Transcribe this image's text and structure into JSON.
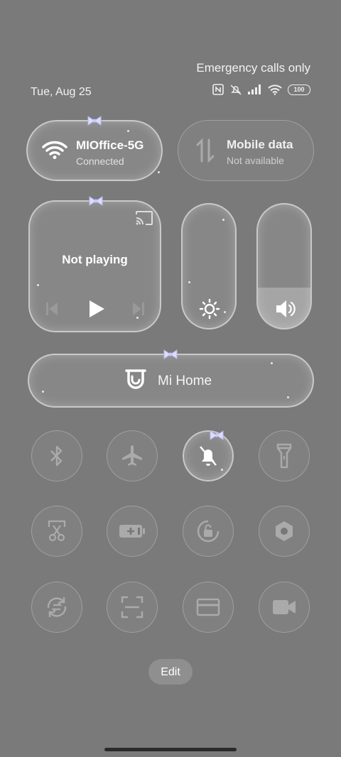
{
  "status_bar": {
    "emergency_text": "Emergency calls only",
    "date": "Tue, Aug 25",
    "battery_level": "100",
    "icons": [
      "nfc-icon",
      "bell-off-icon",
      "signal-icon",
      "wifi-icon",
      "battery-icon"
    ]
  },
  "wifi_tile": {
    "title": "MIOffice-5G",
    "subtitle": "Connected"
  },
  "mobile_tile": {
    "title": "Mobile data",
    "subtitle": "Not available"
  },
  "media_tile": {
    "title": "Not playing"
  },
  "brightness": {
    "level": 0.0
  },
  "volume": {
    "level": 0.33
  },
  "mi_home": {
    "label": "Mi Home"
  },
  "toggles": [
    {
      "name": "bluetooth",
      "active": false
    },
    {
      "name": "airplane-mode",
      "active": false
    },
    {
      "name": "silent",
      "active": true
    },
    {
      "name": "flashlight",
      "active": false
    },
    {
      "name": "screenshot",
      "active": false
    },
    {
      "name": "battery-saver",
      "active": false
    },
    {
      "name": "rotation-lock",
      "active": false
    },
    {
      "name": "settings",
      "active": false
    },
    {
      "name": "sync",
      "active": false
    },
    {
      "name": "scanner",
      "active": false
    },
    {
      "name": "card",
      "active": false
    },
    {
      "name": "screen-record",
      "active": false
    }
  ],
  "edit_label": "Edit",
  "colors": {
    "background": "#7a7a7a",
    "bow": "#c8c8ff"
  }
}
